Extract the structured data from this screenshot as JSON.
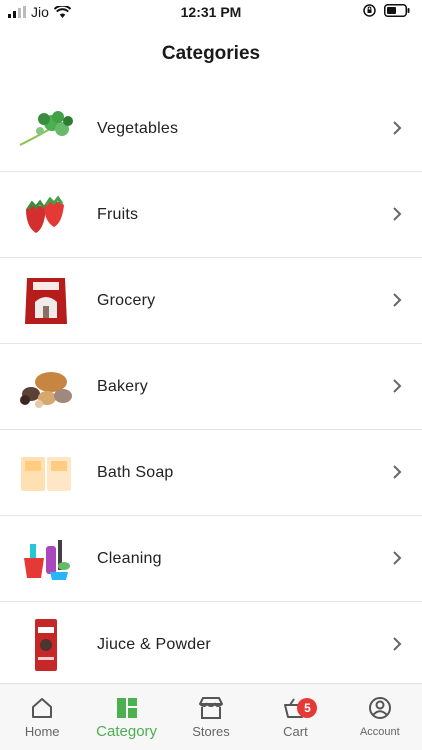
{
  "status_bar": {
    "carrier": "Jio",
    "time": "12:31 PM"
  },
  "header": {
    "title": "Categories"
  },
  "categories": [
    {
      "label": "Vegetables",
      "icon": "vegetables-image"
    },
    {
      "label": "Fruits",
      "icon": "fruits-image"
    },
    {
      "label": "Grocery",
      "icon": "grocery-image"
    },
    {
      "label": "Bakery",
      "icon": "bakery-image"
    },
    {
      "label": "Bath Soap",
      "icon": "bath-soap-image"
    },
    {
      "label": "Cleaning",
      "icon": "cleaning-image"
    },
    {
      "label": "Jiuce & Powder",
      "icon": "juice-powder-image"
    }
  ],
  "tabbar": {
    "home": "Home",
    "category": "Category",
    "stores": "Stores",
    "cart": "Cart",
    "cart_count": "5",
    "account": "Account"
  },
  "colors": {
    "accent": "#4caf50",
    "badge": "#e53935"
  }
}
